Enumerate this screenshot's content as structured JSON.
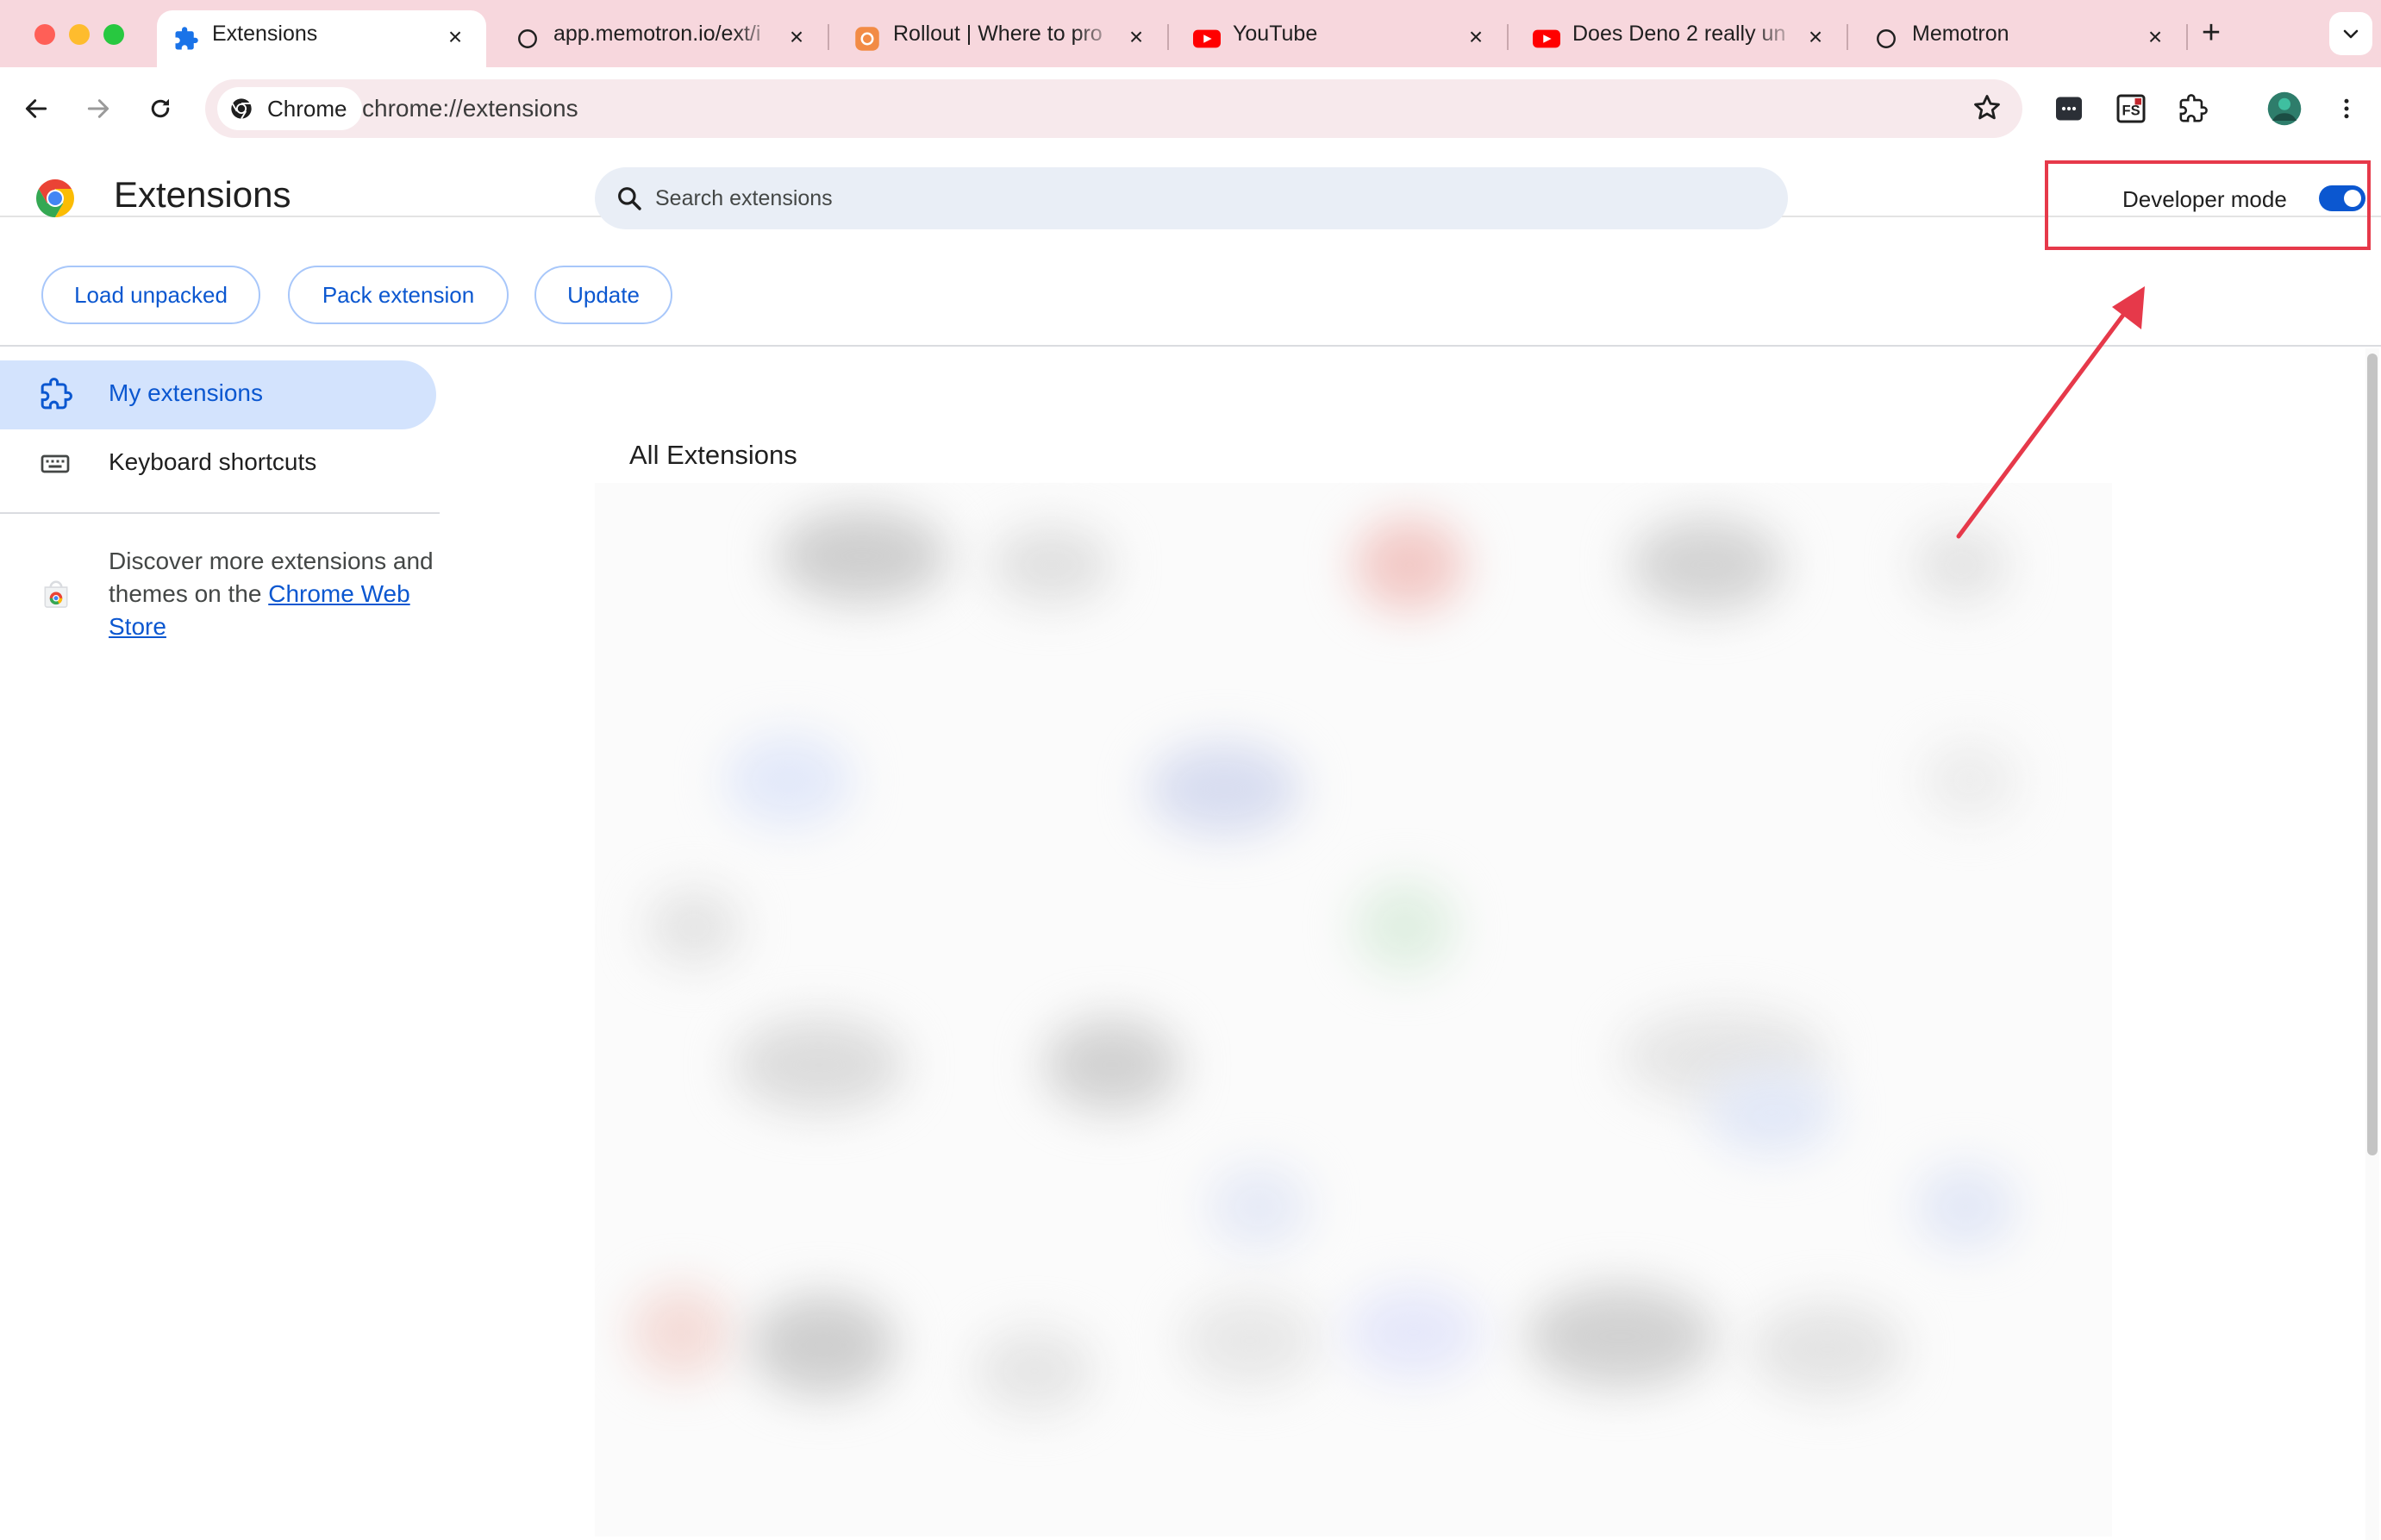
{
  "window": {
    "traffic_colors": [
      "#ff5f57",
      "#febc2e",
      "#28c840"
    ]
  },
  "tabs": [
    {
      "title": "Extensions",
      "icon": "puzzle-icon",
      "active": true
    },
    {
      "title": "app.memotron.io/ext/i",
      "icon": "globe-icon",
      "active": false
    },
    {
      "title": "Rollout | Where to pro",
      "icon": "rollout-icon",
      "active": false
    },
    {
      "title": "YouTube",
      "icon": "youtube-icon",
      "active": false
    },
    {
      "title": "Does Deno 2 really un",
      "icon": "youtube-icon",
      "active": false
    },
    {
      "title": "Memotron",
      "icon": "globe-icon",
      "active": false
    }
  ],
  "toolbar": {
    "chip_label": "Chrome",
    "url": "chrome://extensions",
    "extension_icons": [
      "memotron-ext-icon",
      "fs-ext-icon",
      "extensions-puzzle-icon",
      "profile-avatar"
    ]
  },
  "page": {
    "title": "Extensions",
    "search_placeholder": "Search extensions",
    "developer_mode_label": "Developer mode",
    "developer_mode_on": true,
    "actions": {
      "load_unpacked": "Load unpacked",
      "pack_extension": "Pack extension",
      "update": "Update"
    }
  },
  "sidebar": {
    "items": [
      {
        "label": "My extensions",
        "icon": "puzzle-icon",
        "selected": true
      },
      {
        "label": "Keyboard shortcuts",
        "icon": "keyboard-icon",
        "selected": false
      }
    ],
    "discover_text": "Discover more extensions and themes on the ",
    "store_link": "Chrome Web Store"
  },
  "main": {
    "section_title": "All Extensions"
  },
  "annotation": {
    "color": "#e6394a"
  }
}
